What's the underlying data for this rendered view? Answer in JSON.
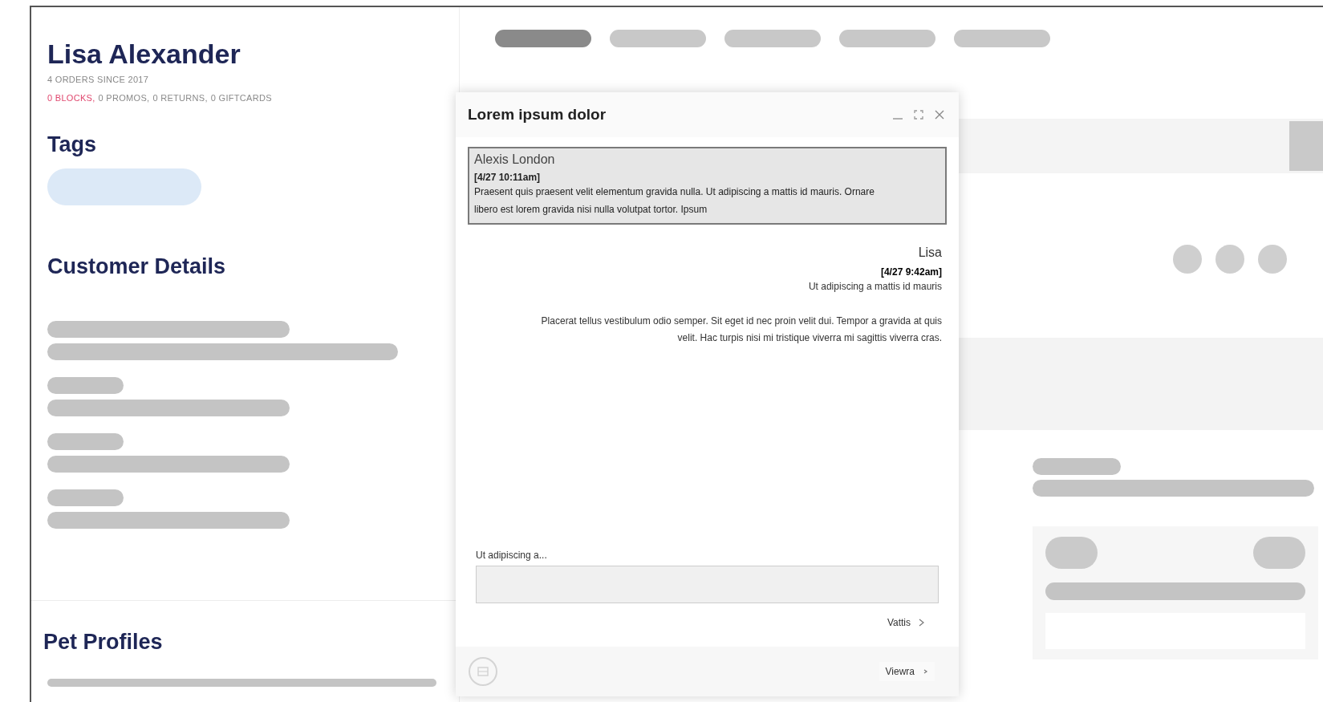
{
  "customer": {
    "name": "Lisa Alexander",
    "orders_since": "4 ORDERS SINCE 2017",
    "stats": [
      {
        "text": "0 BLOCKS,",
        "color": "#e0476e"
      },
      {
        "text": "0 PROMOS,",
        "color": "#8a8a8a"
      },
      {
        "text": "0 RETURNS,",
        "color": "#8a8a8a"
      },
      {
        "text": "0 GIFTCARDS",
        "color": "#8a8a8a"
      }
    ]
  },
  "headings": {
    "tags": "Tags",
    "details": "Customer Details",
    "pets": "Pet Profiles"
  },
  "nav_tabs": [
    {
      "selected": true
    },
    {
      "selected": false
    },
    {
      "selected": false
    },
    {
      "selected": false
    },
    {
      "selected": false
    }
  ],
  "chat": {
    "title": "Lorem ipsum dolor",
    "quoted": {
      "author": "Alexis London",
      "time": "[4/27 10:11am]",
      "text": "Praesent quis praesent velit elementum gravida nulla. Ut adipiscing a mattis id mauris. Ornare libero est lorem gravida nisi nulla volutpat tortor. Ipsum"
    },
    "messages": [
      {
        "author": "Lisa",
        "time": "[4/27 9:42am]",
        "text": "Ut adipiscing a mattis id mauris"
      },
      {
        "text": "Placerat tellus vestibulum odio semper. Sit eget id nec proin velit dui. Tempor a gravida at quis velit. Hac turpis nisi mi tristique viverra mi sagittis viverra cras."
      }
    ],
    "reply_label": "Ut adipiscing a...",
    "send_button": "Vattis",
    "footer_button": "Viewra"
  }
}
